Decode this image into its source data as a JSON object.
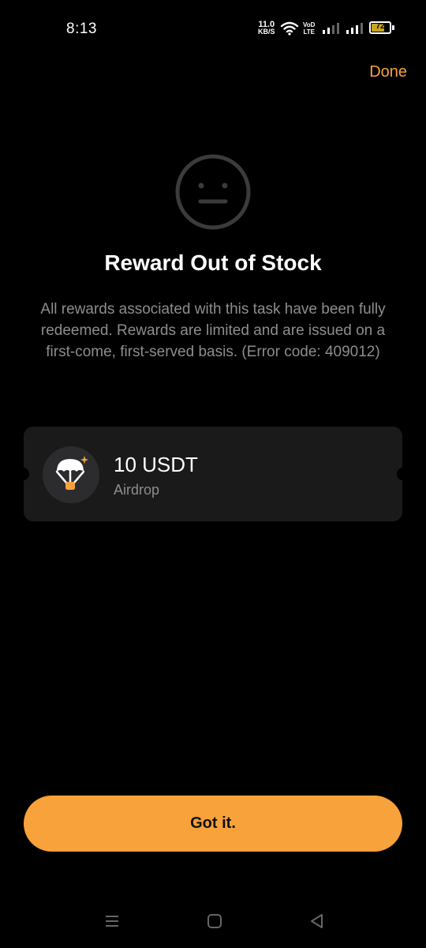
{
  "status_bar": {
    "time": "8:13",
    "net_speed_value": "11.0",
    "net_speed_unit": "KB/S",
    "volte_top": "VoD",
    "volte_bottom": "LTE",
    "battery_level": "72",
    "battery_fraction": 0.72,
    "icons": [
      "wifi-icon",
      "signal-sim1-icon",
      "signal-sim2-icon",
      "battery-icon"
    ]
  },
  "header": {
    "done_label": "Done"
  },
  "message": {
    "icon": "neutral-face-icon",
    "title": "Reward Out of Stock",
    "description": "All rewards associated with this task have been fully redeemed. Rewards are limited and are issued on a first-come, first-served basis. (Error code: 409012)"
  },
  "reward": {
    "icon": "parachute-airdrop-icon",
    "amount": "10 USDT",
    "type": "Airdrop"
  },
  "actions": {
    "primary_label": "Got it."
  },
  "nav_bar": {
    "icons": [
      "menu-icon",
      "home-icon",
      "back-icon"
    ]
  },
  "colors": {
    "accent": "#f7a23b",
    "background": "#000000",
    "card": "#1a1a1a",
    "muted_text": "#8d8d8f"
  }
}
